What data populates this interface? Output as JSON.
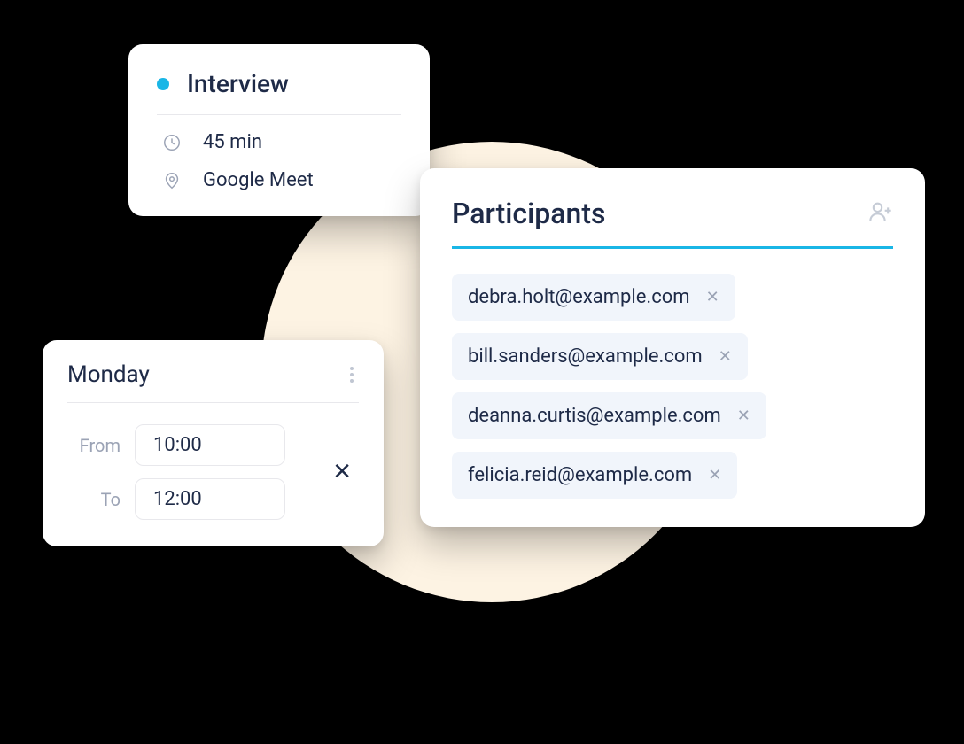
{
  "interview": {
    "title": "Interview",
    "duration": "45 min",
    "location": "Google Meet"
  },
  "day": {
    "name": "Monday",
    "from_label": "From",
    "to_label": "To",
    "from_value": "10:00",
    "to_value": "12:00"
  },
  "participants": {
    "title": "Participants",
    "items": [
      {
        "email": "debra.holt@example.com"
      },
      {
        "email": "bill.sanders@example.com"
      },
      {
        "email": "deanna.curtis@example.com"
      },
      {
        "email": "felicia.reid@example.com"
      }
    ]
  }
}
